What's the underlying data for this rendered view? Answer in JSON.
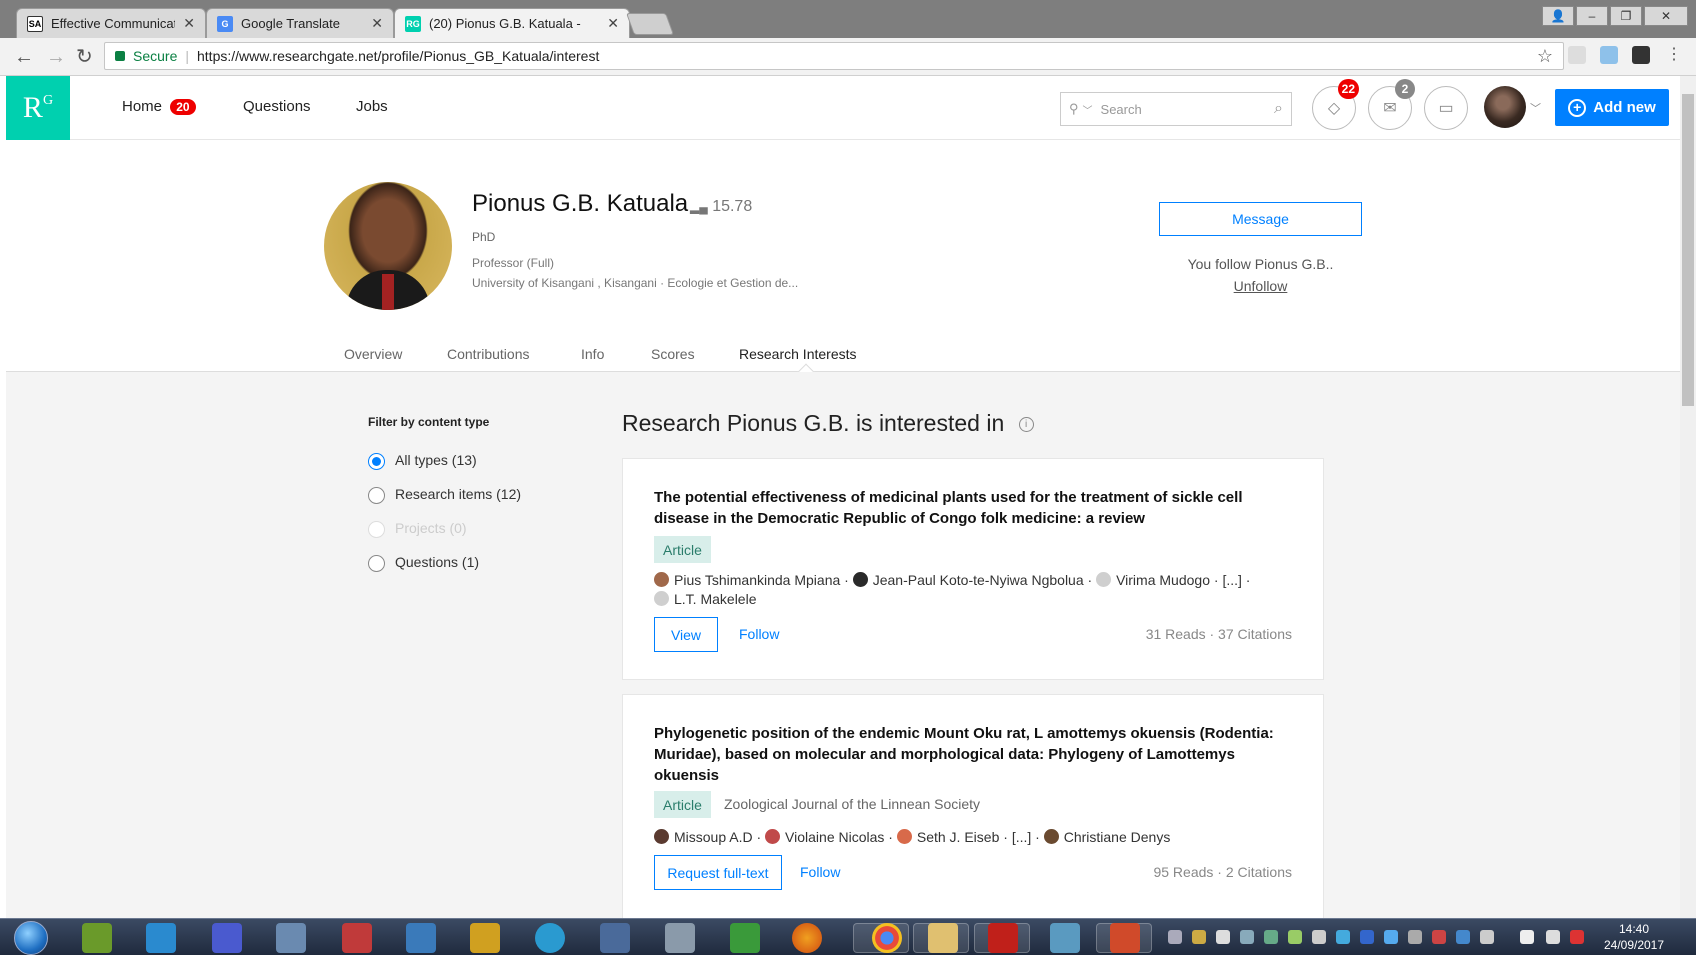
{
  "browser": {
    "tabs": [
      {
        "label": "Effective Communication",
        "favicon_text": "SA",
        "active": false
      },
      {
        "label": "Google Translate",
        "favicon_text": "G",
        "active": false
      },
      {
        "label": "(20) Pionus G.B. Katuala -",
        "favicon_text": "RG",
        "active": true
      }
    ],
    "secure_label": "Secure",
    "url": "https://www.researchgate.net/profile/Pionus_GB_Katuala/interest"
  },
  "header": {
    "logo_text": "R",
    "logo_sup": "G",
    "nav": [
      {
        "label": "Home",
        "badge": "20"
      },
      {
        "label": "Questions"
      },
      {
        "label": "Jobs"
      }
    ],
    "search_placeholder": "Search",
    "notifications_badge": "22",
    "messages_badge": "2",
    "add_new_label": "Add new"
  },
  "profile": {
    "name": "Pionus G.B. Katuala",
    "score": "15.78",
    "degree": "PhD",
    "position": "Professor (Full)",
    "affiliation": "University of Kisangani , Kisangani · Ecologie et Gestion de...",
    "message_label": "Message",
    "follow_note": "You follow Pionus G.B..",
    "unfollow_label": "Unfollow",
    "tabs": [
      "Overview",
      "Contributions",
      "Info",
      "Scores",
      "Research Interests"
    ]
  },
  "filter": {
    "title": "Filter by content type",
    "options": [
      {
        "label": "All types (13)",
        "selected": true,
        "disabled": false
      },
      {
        "label": "Research items (12)",
        "selected": false,
        "disabled": false
      },
      {
        "label": "Projects (0)",
        "selected": false,
        "disabled": true
      },
      {
        "label": "Questions (1)",
        "selected": false,
        "disabled": false
      }
    ]
  },
  "section_title": "Research Pionus G.B. is interested  in",
  "items": [
    {
      "title": "The potential effectiveness of medicinal plants used for the treatment of sickle cell disease in the Democratic Republic of Congo folk medicine: a review",
      "type": "Article",
      "journal": "",
      "authors": [
        "Pius Tshimankinda Mpiana",
        "Jean-Paul Koto-te-Nyiwa Ngbolua",
        "Virima Mudogo",
        "[...]",
        "L.T. Makelele"
      ],
      "primary_action": "View",
      "follow_label": "Follow",
      "stats": "31 Reads · 37 Citations"
    },
    {
      "title": "Phylogenetic position of the endemic Mount Oku rat, L amottemys okuensis (Rodentia: Muridae), based on molecular and morphological data: Phylogeny of Lamottemys okuensis",
      "type": "Article",
      "journal": "Zoological Journal of the Linnean Society",
      "authors": [
        "Missoup A.D",
        "Violaine Nicolas",
        "Seth J. Eiseb",
        "[...]",
        "Christiane Denys"
      ],
      "primary_action": "Request full-text",
      "follow_label": "Follow",
      "stats": "95 Reads · 2 Citations"
    }
  ],
  "taskbar": {
    "time": "14:40",
    "date": "24/09/2017"
  },
  "colors": {
    "rg_teal": "#00d0af",
    "accent_blue": "#0080ff",
    "badge_red": "#e00000"
  }
}
